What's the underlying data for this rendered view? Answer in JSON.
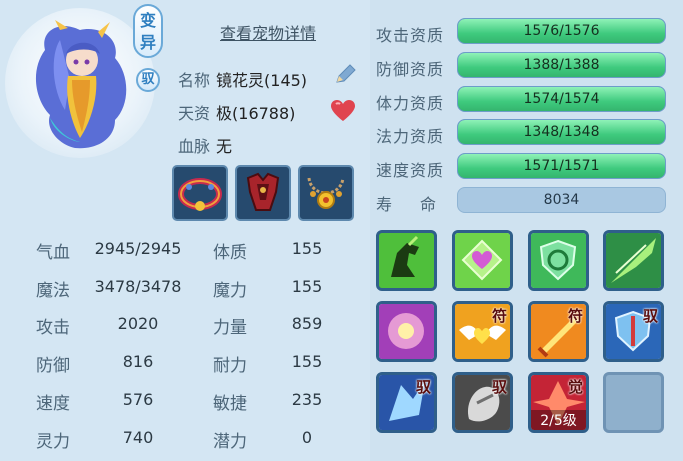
{
  "header": {
    "view_details": "查看宠物详情"
  },
  "badges": {
    "mutant": "变异",
    "tame": "驭"
  },
  "info": {
    "name_label": "名称",
    "name_value": "镜花灵(145)",
    "talent_label": "天资",
    "talent_value": "极(16788)",
    "bloodline_label": "血脉",
    "bloodline_value": "无"
  },
  "stats": [
    {
      "label": "气血",
      "value": "2945/2945"
    },
    {
      "label": "魔法",
      "value": "3478/3478"
    },
    {
      "label": "攻击",
      "value": "2020"
    },
    {
      "label": "防御",
      "value": "816"
    },
    {
      "label": "速度",
      "value": "576"
    },
    {
      "label": "灵力",
      "value": "740"
    }
  ],
  "attributes": [
    {
      "label": "体质",
      "value": "155"
    },
    {
      "label": "魔力",
      "value": "155"
    },
    {
      "label": "力量",
      "value": "859"
    },
    {
      "label": "耐力",
      "value": "155"
    },
    {
      "label": "敏捷",
      "value": "235"
    },
    {
      "label": "潜力",
      "value": "0"
    }
  ],
  "aptitudes": [
    {
      "label": "攻击资质",
      "value": "1576/1576",
      "fill": 1.0
    },
    {
      "label": "防御资质",
      "value": "1388/1388",
      "fill": 1.0
    },
    {
      "label": "体力资质",
      "value": "1574/1574",
      "fill": 1.0
    },
    {
      "label": "法力资质",
      "value": "1348/1348",
      "fill": 1.0
    },
    {
      "label": "速度资质",
      "value": "1571/1571",
      "fill": 1.0
    }
  ],
  "lifespan": {
    "label": "寿　命",
    "value": "8034"
  },
  "skills": {
    "tag_fu": "符",
    "tag_yu": "驭",
    "tag_jue": "觉",
    "level_text": "2/5级"
  },
  "icons": {
    "edit": "pencil-icon",
    "favorite": "heart-icon",
    "equip": [
      "collar-equipment-icon",
      "armor-equipment-icon",
      "necklace-equipment-icon"
    ]
  },
  "colors": {
    "aptitude_fill": "#3fca7e",
    "panel": "#d4e6f3",
    "heart": "#e0444f"
  }
}
